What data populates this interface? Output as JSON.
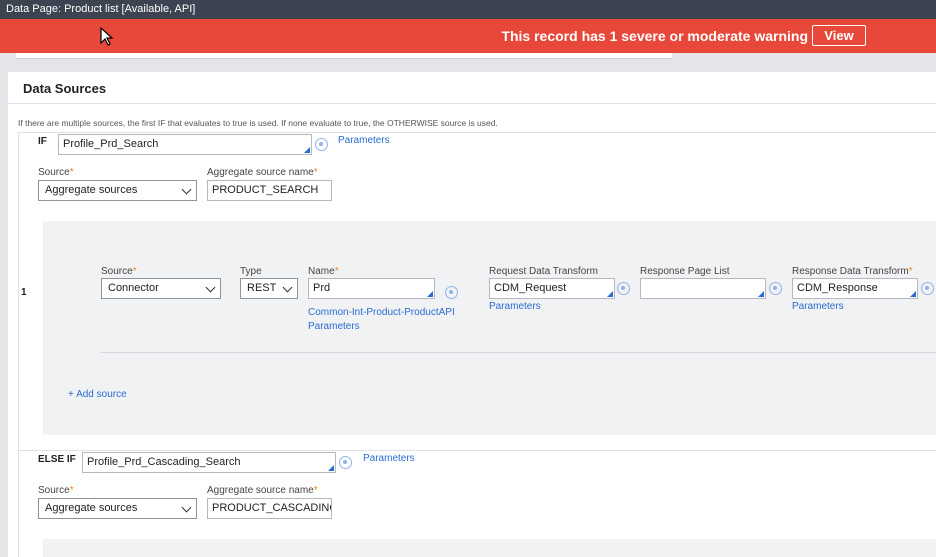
{
  "window": {
    "title": "Data Page: Product list [Available, API]"
  },
  "warning": {
    "message": "This record has 1 severe or moderate warning",
    "view_label": "View"
  },
  "section": {
    "title": "Data Sources",
    "hint": "If there are multiple sources, the first IF that evaluates to true is used. If none evaluate to true, the OTHERWISE source is used."
  },
  "if_block": {
    "keyword": "IF",
    "condition": "Profile_Prd_Search",
    "parameters_label": "Parameters",
    "source_label": "Source",
    "source_value": "Aggregate sources",
    "agg_name_label": "Aggregate source name",
    "agg_name_value": "PRODUCT_SEARCH",
    "row_number": "1",
    "inner": {
      "source_label": "Source",
      "source_value": "Connector",
      "type_label": "Type",
      "type_value": "REST",
      "name_label": "Name",
      "name_value": "Prd",
      "name_link": "Common-Int-Product-ProductAPI",
      "name_params": "Parameters",
      "req_dt_label": "Request Data Transform",
      "req_dt_value": "CDM_Request",
      "req_dt_params": "Parameters",
      "resp_page_label": "Response Page List",
      "resp_page_value": "",
      "resp_dt_label": "Response Data Transform",
      "resp_dt_value": "CDM_Response",
      "resp_dt_params": "Parameters"
    },
    "add_source_label": "+ Add source"
  },
  "elseif_block": {
    "keyword": "ELSE IF",
    "condition": "Profile_Prd_Cascading_Search",
    "parameters_label": "Parameters",
    "source_label": "Source",
    "source_value": "Aggregate sources",
    "agg_name_label": "Aggregate source name",
    "agg_name_value": "PRODUCT_CASCADING_SE"
  },
  "colors": {
    "warning_bg": "#e8483a",
    "title_bg": "#3d4350",
    "link": "#2a6cd0",
    "required": "#e8851f"
  }
}
